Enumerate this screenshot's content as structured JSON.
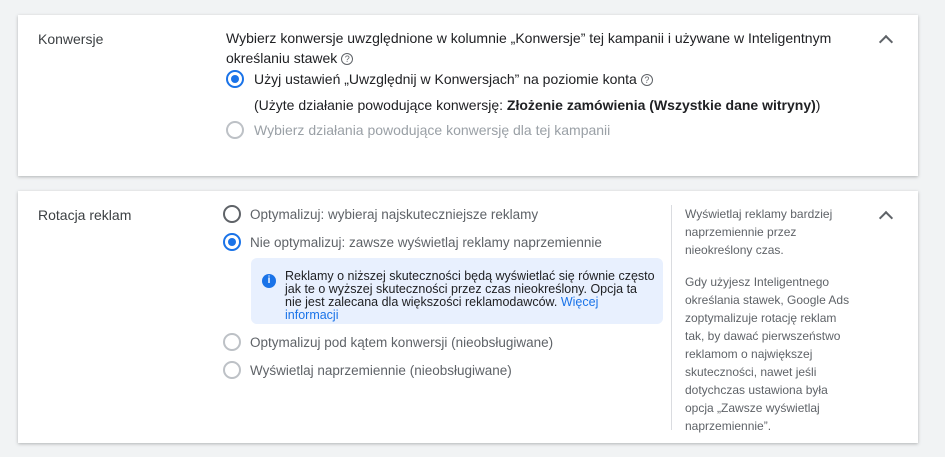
{
  "conversions": {
    "label": "Konwersje",
    "title": "Wybierz konwersje uwzględnione w kolumnie „Konwersje” tej kampanii i używane w Inteligentnym określaniu stawek",
    "option_account": "Użyj ustawień „Uwzględnij w Konwersjach” na poziomie konta",
    "used_action_prefix": "(Użyte działanie powodujące konwersję: ",
    "used_action_value": "Złożenie zamówienia (Wszystkie dane witryny)",
    "used_action_suffix": ")",
    "option_campaign": "Wybierz działania powodujące konwersję dla tej kampanii",
    "selected": "account"
  },
  "rotation": {
    "label": "Rotacja reklam",
    "options": [
      {
        "label": "Optymalizuj: wybieraj najskuteczniejsze reklamy",
        "state": "unselected"
      },
      {
        "label": "Nie optymalizuj: zawsze wyświetlaj reklamy naprzemiennie",
        "state": "selected"
      },
      {
        "label": "Optymalizuj pod kątem konwersji (nieobsługiwane)",
        "state": "disabled"
      },
      {
        "label": "Wyświetlaj naprzemiennie (nieobsługiwane)",
        "state": "disabled"
      }
    ],
    "info_text": "Reklamy o niższej skuteczności będą wyświetlać się równie często jak te o wyższej skuteczności przez czas nieokreślony. Opcja ta nie jest zalecana dla większości reklamodawców.",
    "info_link": "Więcej informacji",
    "side_p1": "Wyświetlaj reklamy bardziej naprzemiennie przez nieokreślony czas.",
    "side_p2": "Gdy użyjesz Inteligentnego określania stawek, Google Ads zoptymalizuje rotację reklam tak, by dawać pierwszeństwo reklamom o największej skuteczności, nawet jeśli dotychczas ustawiona była opcja „Zawsze wyświetlaj naprzemiennie”."
  },
  "icons": {
    "help": "?",
    "info": "i",
    "collapse": "chevron-up-icon"
  },
  "colors": {
    "accent": "#1a73e8",
    "info_bg": "#e8f0fe"
  }
}
